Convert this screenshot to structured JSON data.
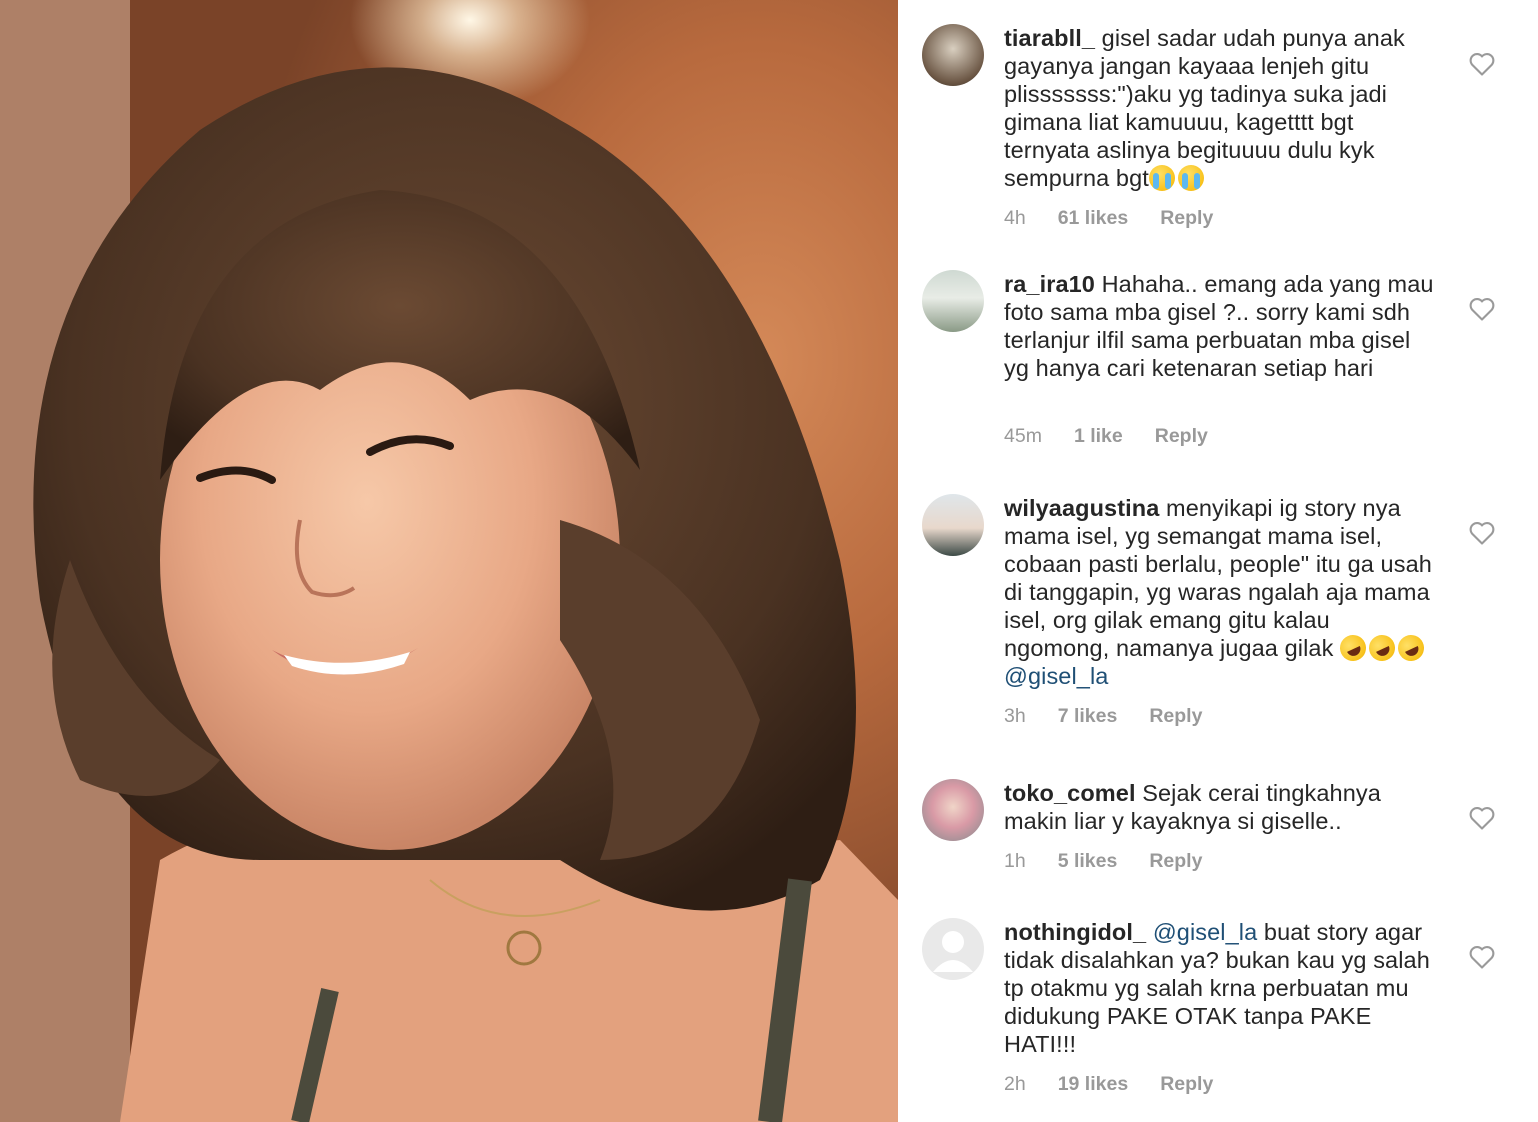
{
  "photo": {
    "alt": "selfie"
  },
  "comments": [
    {
      "username": "tiarabll_",
      "text": "gisel sadar udah punya anak gayanya jangan kayaaa lenjeh gitu plisssssss:\")aku yg tadinya suka jadi gimana liat kamuuuu, kagetttt bgt ternyata aslinya begituuuu dulu kyk sempurna bgt",
      "emojis": [
        "loudly-crying-face",
        "loudly-crying-face"
      ],
      "mention": "",
      "time": "4h",
      "likes": "61 likes",
      "reply": "Reply"
    },
    {
      "username": "ra_ira10",
      "text": "Hahaha.. emang ada yang mau foto sama mba gisel ?.. sorry kami sdh terlanjur ilfil sama perbuatan mba gisel yg hanya cari ketenaran setiap hari",
      "emojis": [],
      "mention": "",
      "time": "45m",
      "likes": "1 like",
      "reply": "Reply"
    },
    {
      "username": "wilyaagustina",
      "text": "menyikapi ig story nya mama isel, yg semangat mama isel, cobaan pasti berlalu, people\" itu ga usah di tanggapin, yg waras ngalah aja mama isel, org gilak emang gitu kalau ngomong, namanya jugaa gilak",
      "emojis": [
        "rolling-on-floor-laughing",
        "rolling-on-floor-laughing",
        "rolling-on-floor-laughing"
      ],
      "mention": "@gisel_la",
      "time": "3h",
      "likes": "7 likes",
      "reply": "Reply"
    },
    {
      "username": "toko_comel",
      "text": "Sejak cerai tingkahnya makin liar y kayaknya si giselle..",
      "emojis": [],
      "mention": "",
      "time": "1h",
      "likes": "5 likes",
      "reply": "Reply"
    },
    {
      "username": "nothingidol_",
      "mention_lead": "@gisel_la",
      "text": "buat story agar tidak disalahkan ya? bukan kau yg salah tp otakmu yg salah krna perbuatan mu didukung PAKE OTAK tanpa PAKE HATI!!!",
      "emojis": [],
      "mention": "",
      "time": "2h",
      "likes": "19 likes",
      "reply": "Reply"
    }
  ],
  "colors": {
    "text": "#262626",
    "meta": "#999999",
    "mention": "#1f4f75",
    "heart": "#9a9a9a"
  }
}
